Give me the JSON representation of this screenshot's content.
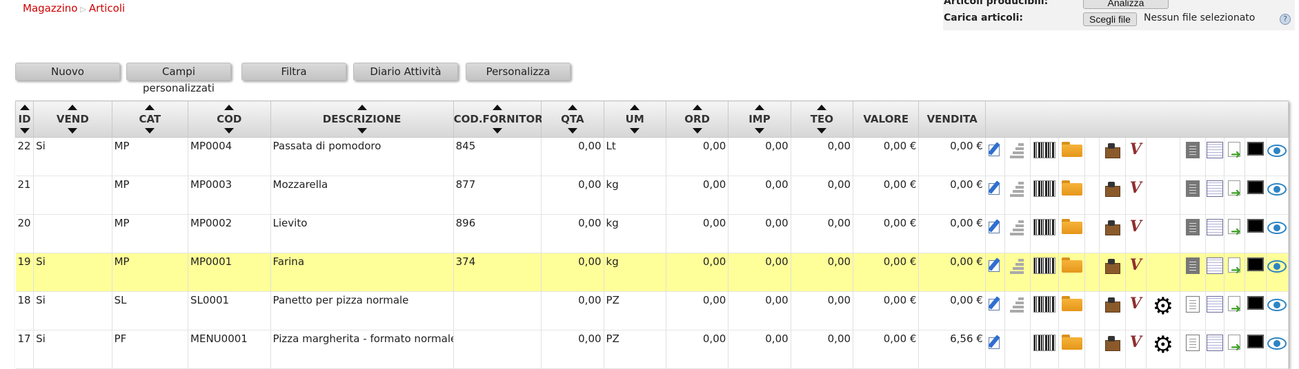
{
  "breadcrumb": {
    "root": "Magazzino",
    "current": "Articoli"
  },
  "import": {
    "producible_label": "Articoli producibili:",
    "analyze_button": "Analizza",
    "upload_label": "Carica articoli:",
    "choose_file_button": "Scegli file",
    "no_file_text": "Nessun file selezionato",
    "help": "?"
  },
  "toolbar": {
    "new": "Nuovo",
    "custom_fields": "Campi personalizzati",
    "filter": "Filtra",
    "activity_log": "Diario Attività",
    "customize": "Personalizza"
  },
  "table": {
    "headers": {
      "id": "ID",
      "vend": "VEND",
      "cat": "CAT",
      "cod": "COD",
      "descrizione": "DESCRIZIONE",
      "cod_fornitore": "COD.FORNITORE",
      "qta": "QTA",
      "um": "UM",
      "ord": "ORD",
      "imp": "IMP",
      "teo": "TEO",
      "valore": "VALORE",
      "vendita": "VENDITA"
    },
    "rows": [
      {
        "id": "22",
        "vend": "Si",
        "cat": "MP",
        "cod": "MP0004",
        "desc": "Passata di pomodoro",
        "codf": "845",
        "qta": "0,00",
        "um": "Lt",
        "ord": "0,00",
        "imp": "0,00",
        "teo": "0,00",
        "valore": "0,00 €",
        "vendita": "0,00 €"
      },
      {
        "id": "21",
        "vend": "",
        "cat": "MP",
        "cod": "MP0003",
        "desc": "Mozzarella",
        "codf": "877",
        "qta": "0,00",
        "um": "kg",
        "ord": "0,00",
        "imp": "0,00",
        "teo": "0,00",
        "valore": "0,00 €",
        "vendita": "0,00 €"
      },
      {
        "id": "20",
        "vend": "",
        "cat": "MP",
        "cod": "MP0002",
        "desc": "Lievito",
        "codf": "896",
        "qta": "0,00",
        "um": "kg",
        "ord": "0,00",
        "imp": "0,00",
        "teo": "0,00",
        "valore": "0,00 €",
        "vendita": "0,00 €"
      },
      {
        "id": "19",
        "vend": "Si",
        "cat": "MP",
        "cod": "MP0001",
        "desc": "Farina",
        "codf": "374",
        "qta": "0,00",
        "um": "kg",
        "ord": "0,00",
        "imp": "0,00",
        "teo": "0,00",
        "valore": "0,00 €",
        "vendita": "0,00 €"
      },
      {
        "id": "18",
        "vend": "Si",
        "cat": "SL",
        "cod": "SL0001",
        "desc": "Panetto per pizza normale",
        "codf": "",
        "qta": "0,00",
        "um": "PZ",
        "ord": "0,00",
        "imp": "0,00",
        "teo": "0,00",
        "valore": "0,00 €",
        "vendita": "0,00 €"
      },
      {
        "id": "17",
        "vend": "Si",
        "cat": "PF",
        "cod": "MENU0001",
        "desc": "Pizza margherita - formato normale",
        "codf": "",
        "qta": "0,00",
        "um": "PZ",
        "ord": "0,00",
        "imp": "0,00",
        "teo": "0,00",
        "valore": "0,00 €",
        "vendita": "6,56 €"
      }
    ]
  },
  "colors": {
    "breadcrumb": "#d10000",
    "highlight_row": "#ffff99"
  },
  "icons": [
    "edit-icon",
    "stock-bars-icon",
    "barcode-icon",
    "folder-icon",
    "warehouse-box-icon",
    "variant-v-icon",
    "gears-icon",
    "document-icon",
    "table-icon",
    "export-icon",
    "terminal-icon",
    "eye-icon"
  ]
}
